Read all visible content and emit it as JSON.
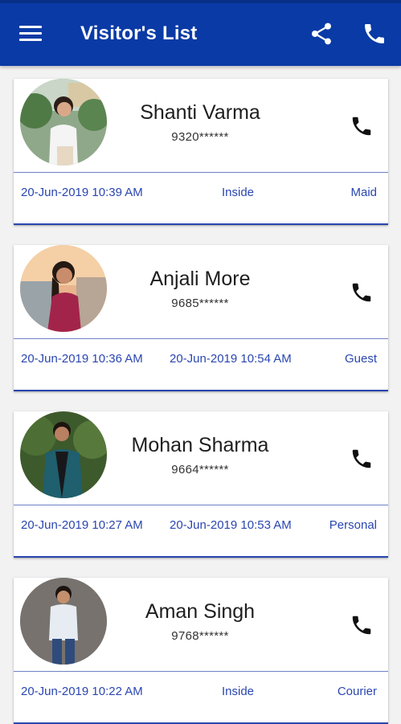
{
  "app_bar": {
    "title": "Visitor's List",
    "menu_icon": "hamburger-menu-icon",
    "share_icon": "share-icon",
    "call_icon": "phone-icon",
    "color": "#0a3aa6"
  },
  "visitors": [
    {
      "name": "Shanti Varma",
      "phone": "9320******",
      "in_time": "20-Jun-2019 10:39 AM",
      "status": "Inside",
      "type": "Maid",
      "avatar_icon": "person-photo"
    },
    {
      "name": "Anjali More",
      "phone": "9685******",
      "in_time": "20-Jun-2019 10:36 AM",
      "out_time": "20-Jun-2019 10:54 AM",
      "type": "Guest",
      "avatar_icon": "person-photo"
    },
    {
      "name": "Mohan Sharma",
      "phone": "9664******",
      "in_time": "20-Jun-2019 10:27 AM",
      "out_time": "20-Jun-2019 10:53 AM",
      "type": "Personal",
      "avatar_icon": "person-photo"
    },
    {
      "name": "Aman Singh",
      "phone": "9768******",
      "in_time": "20-Jun-2019 10:22 AM",
      "status": "Inside",
      "type": "Courier",
      "avatar_icon": "person-photo"
    }
  ],
  "colors": {
    "accent_text": "#2a46b0",
    "card_border": "#2a46b0"
  }
}
